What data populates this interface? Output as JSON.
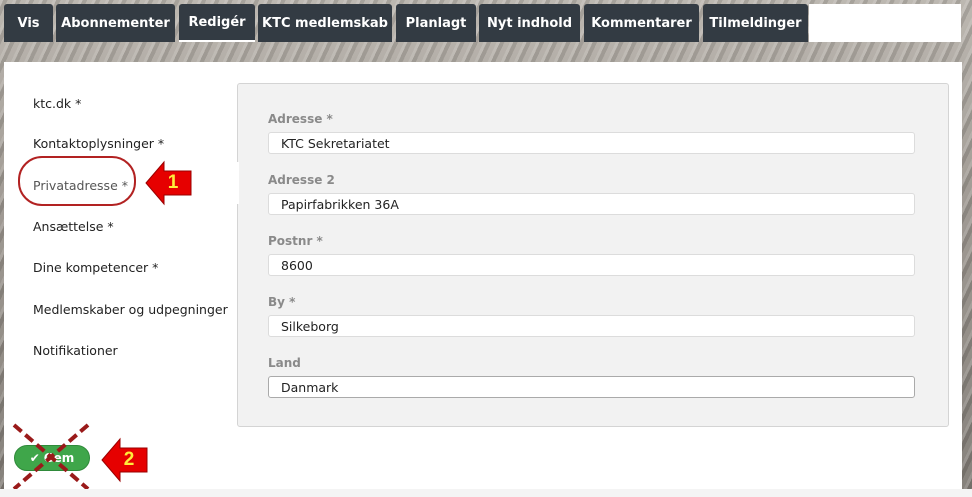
{
  "tabs": [
    {
      "label": "Vis"
    },
    {
      "label": "Abonnementer"
    },
    {
      "label": "Redigér"
    },
    {
      "label": "KTC medlemskab"
    },
    {
      "label": "Planlagt"
    },
    {
      "label": "Nyt indhold"
    },
    {
      "label": "Kommentarer"
    },
    {
      "label": "Tilmeldinger"
    }
  ],
  "sidebar": {
    "items": [
      {
        "label": "ktc.dk *"
      },
      {
        "label": "Kontaktoplysninger *"
      },
      {
        "label": "Privatadresse *"
      },
      {
        "label": "Ansættelse *"
      },
      {
        "label": "Dine kompetencer *"
      },
      {
        "label": "Medlemskaber og udpegninger"
      },
      {
        "label": "Notifikationer"
      }
    ],
    "active_index": 2
  },
  "form": {
    "fields": [
      {
        "label": "Adresse *",
        "value": "KTC Sekretariatet"
      },
      {
        "label": "Adresse 2",
        "value": "Papirfabrikken 36A"
      },
      {
        "label": "Postnr *",
        "value": "8600"
      },
      {
        "label": "By *",
        "value": "Silkeborg"
      },
      {
        "label": "Land",
        "value": "Danmark"
      }
    ]
  },
  "save_button": {
    "label": "Gem"
  },
  "annotations": {
    "callout_1": "1",
    "callout_2": "2"
  },
  "colors": {
    "tab_bg": "#333b43",
    "save_green": "#3fa64a",
    "callout_red": "#e60000",
    "callout_text": "#ffeb3b",
    "ring_red": "#b22222"
  }
}
